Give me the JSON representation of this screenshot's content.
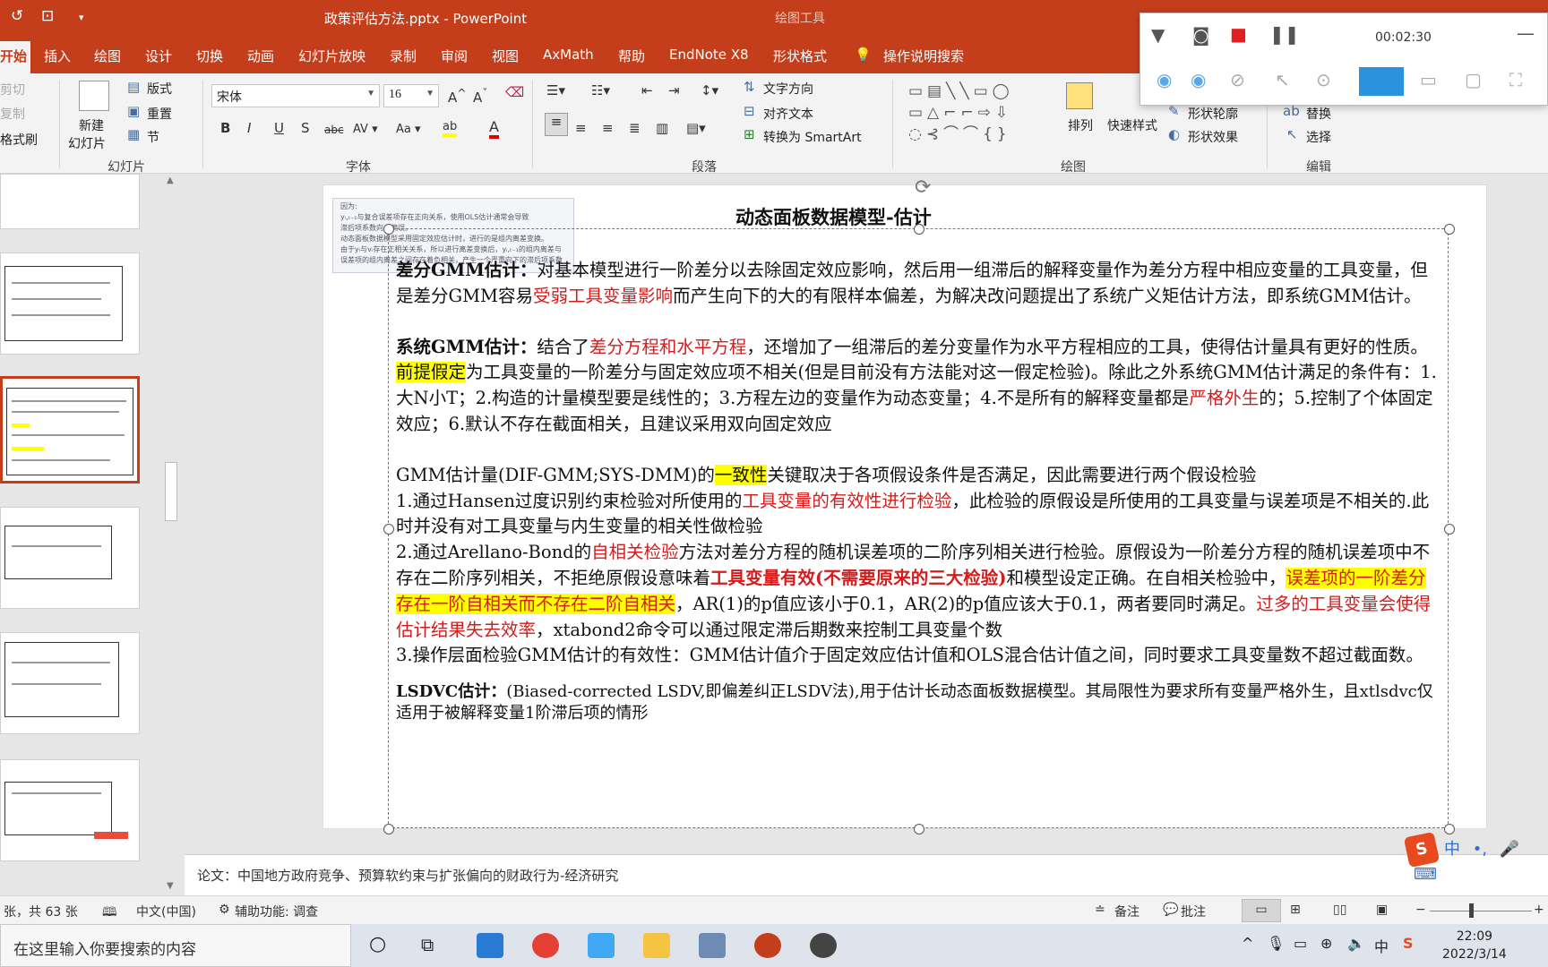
{
  "titlebar": {
    "title": "政策评估方法.pptx  -  PowerPoint",
    "context_label": "绘图工具"
  },
  "tabs": [
    "开始",
    "插入",
    "绘图",
    "设计",
    "切换",
    "动画",
    "幻灯片放映",
    "录制",
    "审阅",
    "视图",
    "AxMath",
    "帮助",
    "EndNote X8",
    "形状格式"
  ],
  "tell_me": "操作说明搜索",
  "ribbon": {
    "clipboard": {
      "cut": "剪切",
      "copy": "复制",
      "format_painter": "格式刷"
    },
    "slides": {
      "new_slide_1": "新建",
      "new_slide_2": "幻灯片",
      "layout": "版式",
      "reset": "重置",
      "section": "节",
      "group": "幻灯片"
    },
    "font": {
      "name": "宋体",
      "size": "16",
      "group": "字体"
    },
    "paragraph": {
      "text_direction": "文字方向",
      "align_text": "对齐文本",
      "smartart": "转换为 SmartArt",
      "group": "段落"
    },
    "drawing": {
      "arrange": "排列",
      "quick_styles": "快速样式",
      "shape_outline": "形状轮廓",
      "shape_effects": "形状效果",
      "group": "绘图"
    },
    "editing": {
      "replace": "替换",
      "select": "选择",
      "group": "编辑"
    }
  },
  "recorder": {
    "time": "00:02:30"
  },
  "slide": {
    "title": "动态面板数据模型-估计",
    "inset": {
      "l1": "因为:",
      "l2": "yᵢ,ₜ₋₁与复合误差项存在正向关系，使用OLS估计通常会导致",
      "l3": "滞后项系数向上偏误。",
      "l4": "动态面板数据模型采用固定效应估计时，进行的是组内离差变换。",
      "l5": "由于yᵢ与vᵢ存在正相关关系，所以进行离差变换后，yᵢ,ₜ₋₁的组内离差与",
      "l6": "误差项的组内离差之间存在着负相关，产生一个严重向下的滞后项系数"
    },
    "p1": {
      "lead": "差分GMM估计：",
      "t1": "对基本模型进行一阶差分以去除固定效应影响，然后用一组滞后的解释变量作为差分方程中相应变量的工具变量，但是差分GMM容易",
      "r1": "受弱工具变量影响",
      "t2": "而产生向下的大的有限样本偏差，为解决改问题提出了系统广义矩估计方法，即系统GMM估计。"
    },
    "p2": {
      "lead": "系统GMM估计：",
      "t1": "结合了",
      "r1": "差分方程和水平方程",
      "t2": "，还增加了一组滞后的差分变量作为水平方程相应的工具，使得估计量具有更好的性质。",
      "y1": "前提假定",
      "t3": "为工具变量的一阶差分与固定效应项不相关(但是目前没有方法能对这一假定检验)。除此之外系统GMM估计满足的条件有：1.大N小T；2.构造的计量模型要是线性的；3.方程左边的变量作为动态变量；4.不是所有的解释变量都是",
      "r2": "严格外生",
      "t4": "的；5.控制了个体固定效应；6.默认不存在截面相关，且建议采用双向固定效应"
    },
    "p3": {
      "t1": "GMM估计量(DIF-GMM;SYS-DMM)的",
      "y1": "一致性",
      "t2": "关键取决于各项假设条件是否满足，因此需要进行两个假设检验"
    },
    "p4": {
      "t1": "1.通过Hansen过度识别约束检验对所使用的",
      "r1": "工具变量的有效性进行检验",
      "t2": "，此检验的原假设是所使用的工具变量与误差项是不相关的.此时并没有对工具变量与内生变量的相关性做检验"
    },
    "p5": {
      "t1": "2.通过Arellano-Bond的",
      "r1": "自相关检验",
      "t2": "方法对差分方程的随机误差项的二阶序列相关进行检验。原假设为一阶差分方程的随机误差项中不存在二阶序列相关，不拒绝原假设意味着",
      "r2": "工具变量有效(不需要原来的三大检验)",
      "t3": "和模型设定正确。在自相关检验中，",
      "y1": "误差项的一阶差分存在一阶自相关而不存在二阶自相关",
      "t4": "，AR(1)的p值应该小于0.1，AR(2)的p值应该大于0.1，两者要同时满足。",
      "r3": "过多的工具变量会使得估计结果失去效率",
      "t5": "，xtabond2命令可以通过限定滞后期数来控制工具变量个数"
    },
    "p6": {
      "t1": "3.操作层面检验GMM估计的有效性：GMM估计值介于固定效应估计值和OLS混合估计值之间，同时要求工具变量数不超过截面数。"
    },
    "p7": {
      "lead": "LSDVC估计：",
      "t1": "(Biased-corrected LSDV,即偏差纠正LSDV法),用于估计长动态面板数据模型。其局限性为要求所有变量严格外生，且xtlsdvc仅适用于被解释变量1阶滞后项的情形"
    }
  },
  "notes": "论文：中国地方政府竞争、预算软约束与扩张偏向的财政行为-经济研究",
  "status": {
    "slide_count": "张，共 63 张",
    "language": "中文(中国)",
    "accessibility": "辅助功能: 调查",
    "notes_btn": "备注",
    "comments_btn": "批注"
  },
  "taskbar": {
    "search_placeholder": "在这里输入你要搜索的内容",
    "time": "22:09",
    "date": "2022/3/14"
  },
  "ime": {
    "label": "中"
  }
}
